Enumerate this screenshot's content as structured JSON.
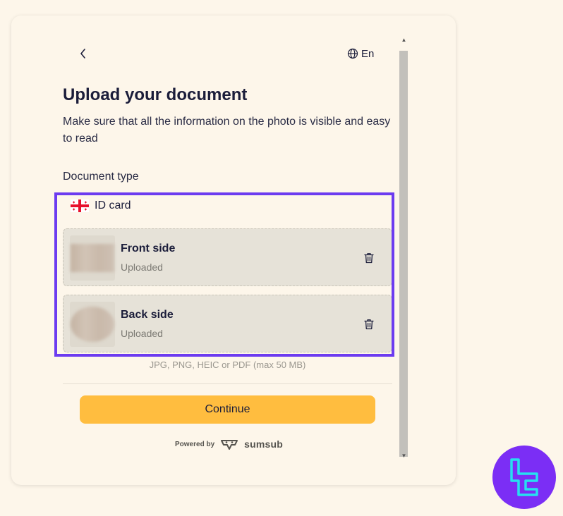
{
  "header": {
    "language_label": "En"
  },
  "page": {
    "title": "Upload your document",
    "subtitle": "Make sure that all the information on the photo is visible and easy to read",
    "document_type_label": "Document type"
  },
  "document": {
    "type_label": "ID card",
    "flag_icon": "georgia-flag-icon",
    "items": [
      {
        "title": "Front side",
        "status": "Uploaded"
      },
      {
        "title": "Back side",
        "status": "Uploaded"
      }
    ],
    "formats_hint": "JPG, PNG, HEIC or PDF (max 50 MB)"
  },
  "actions": {
    "continue_label": "Continue"
  },
  "footer": {
    "powered_by": "Powered by",
    "brand": "sumsub"
  },
  "colors": {
    "background": "#fdf6ea",
    "primary_button": "#ffbd3f",
    "highlight": "#6c3bf0",
    "item_bg": "#e6e2d8",
    "corner_logo": "#7b2ef5"
  }
}
